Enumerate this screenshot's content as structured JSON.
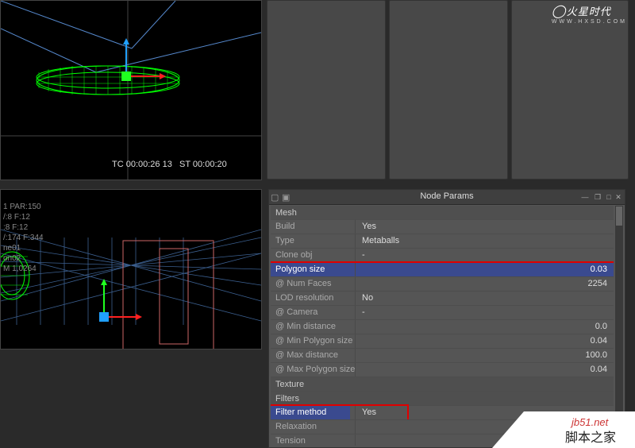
{
  "viewport_top": {
    "timecode": "TC 00:00:26 13",
    "stoptime": "ST 00:00:20"
  },
  "viewport_bottom": {
    "info_line1": "1 PAR:150",
    "info_line2": "/:8 F:12",
    "info_line3": ":8 F:12",
    "info_line4": "/:174  F:344",
    "info_line5": "ne01",
    "info_line6": "on02",
    "info_line7": "M 1,0264"
  },
  "node_params": {
    "title": "Node Params",
    "sections": {
      "mesh": "Mesh",
      "texture": "Texture",
      "filters": "Filters"
    },
    "rows": {
      "build": {
        "k": "Build",
        "v": "Yes"
      },
      "type": {
        "k": "Type",
        "v": "Metaballs"
      },
      "clone_obj": {
        "k": "Clone obj",
        "v": "-"
      },
      "polygon_size": {
        "k": "Polygon size",
        "v": "0.03"
      },
      "num_faces": {
        "k": "@ Num Faces",
        "v": "2254"
      },
      "lod_res": {
        "k": "LOD resolution",
        "v": "No"
      },
      "camera": {
        "k": "@ Camera",
        "v": "-"
      },
      "min_dist": {
        "k": "@ Min distance",
        "v": "0.0"
      },
      "min_poly": {
        "k": "@ Min Polygon size",
        "v": "0.04"
      },
      "max_dist": {
        "k": "@ Max distance",
        "v": "100.0"
      },
      "max_poly": {
        "k": "@ Max Polygon size",
        "v": "0.04"
      },
      "filter_method": {
        "k": "Filter method",
        "v": "Yes"
      },
      "relaxation": {
        "k": "Relaxation",
        "v": ""
      },
      "tension": {
        "k": "Tension",
        "v": ""
      }
    }
  },
  "branding": {
    "logo_main": "火星时代",
    "logo_sub": "WWW.HXSD.COM",
    "wm_domain": "jb51.net",
    "wm_cn": "脚本之家"
  }
}
